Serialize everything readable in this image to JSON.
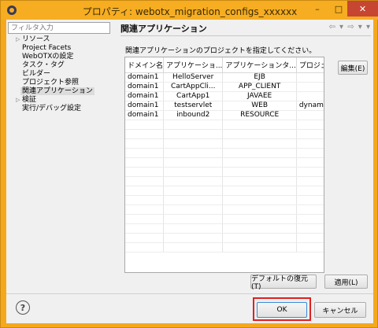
{
  "window": {
    "title": "プロパティ: webotx_migration_configs_xxxxxx",
    "minimize": "–",
    "maximize": "□",
    "close": "✕"
  },
  "filter": {
    "placeholder": "フィルタ入力"
  },
  "tree": [
    {
      "label": "リソース",
      "arrow": "▷"
    },
    {
      "label": "Project Facets",
      "arrow": ""
    },
    {
      "label": "WebOTXの設定",
      "arrow": ""
    },
    {
      "label": "タスク・タグ",
      "arrow": ""
    },
    {
      "label": "ビルダー",
      "arrow": ""
    },
    {
      "label": "プロジェクト参照",
      "arrow": ""
    },
    {
      "label": "関連アプリケーション",
      "arrow": "",
      "selected": true
    },
    {
      "label": "検証",
      "arrow": "▷"
    },
    {
      "label": "実行/デバッグ設定",
      "arrow": ""
    }
  ],
  "page": {
    "title": "関連アプリケーション",
    "nav": "⇦ ▾ ⇨ ▾ ▾",
    "description": "関連アプリケーションのプロジェクトを指定してください。"
  },
  "table": {
    "headers": [
      "ドメイン名",
      "アプリケーショ...",
      "アプリケーションタ...",
      "プロジェク..."
    ],
    "rows": [
      [
        "domain1",
        "HelloServer",
        "EJB",
        ""
      ],
      [
        "domain1",
        "CartAppCli...",
        "APP_CLIENT",
        ""
      ],
      [
        "domain1",
        "CartApp1",
        "JAVAEE",
        ""
      ],
      [
        "domain1",
        "testservlet",
        "WEB",
        "dynami..."
      ],
      [
        "domain1",
        "inbound2",
        "RESOURCE",
        ""
      ]
    ]
  },
  "buttons": {
    "edit": "編集(E)",
    "restore_defaults": "デフォルトの復元(T)",
    "apply": "適用(L)",
    "ok": "OK",
    "cancel": "キャンセル",
    "help": "?"
  }
}
